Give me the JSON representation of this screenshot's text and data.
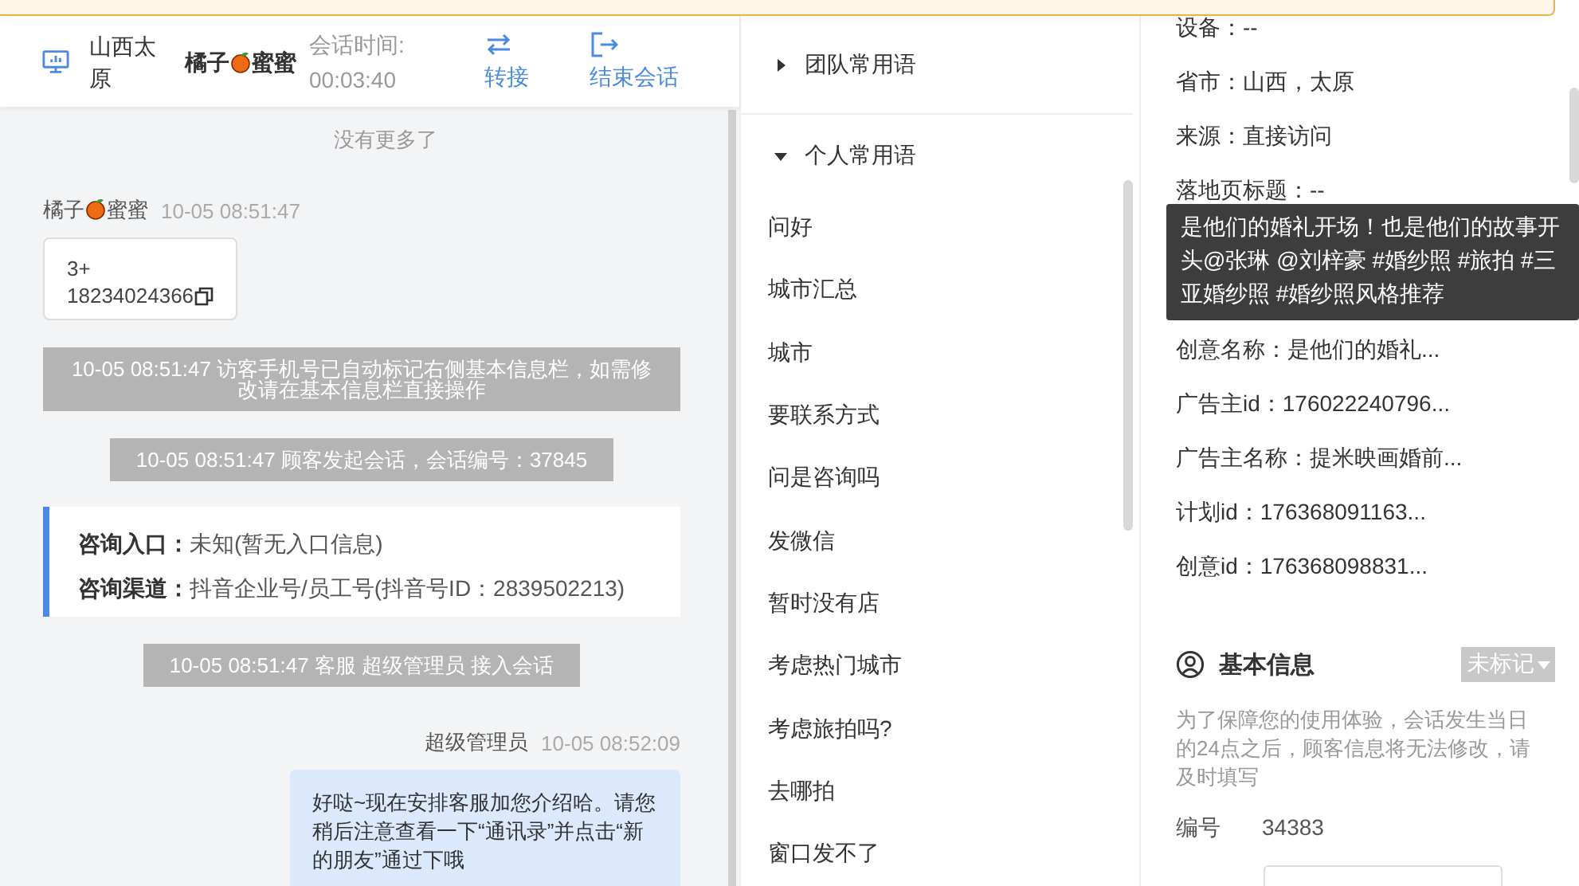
{
  "header": {
    "location": "山西太原",
    "visitor_name_parts": [
      "橘子",
      "蜜蜜"
    ],
    "session_label": "会话时间:",
    "session_time": "00:03:40",
    "actions": [
      {
        "kind": "transfer",
        "label": "转接"
      },
      {
        "kind": "end",
        "label": "结束会话"
      }
    ]
  },
  "chat": {
    "no_more": "没有更多了",
    "messages": [
      {
        "kind": "visitor",
        "name_parts": [
          "橘子",
          "蜜蜜"
        ],
        "time": "10-05 08:51:47",
        "lines": [
          "3+",
          "18234024366"
        ]
      },
      {
        "kind": "system",
        "text": "10-05 08:51:47 访客手机号已自动标记右侧基本信息栏，如需修改请在基本信息栏直接操作"
      },
      {
        "kind": "system",
        "text": "10-05 08:51:47 顾客发起会话，会话编号：37845"
      },
      {
        "kind": "info",
        "rows": [
          {
            "label": "咨询入口：",
            "value": "未知(暂无入口信息)"
          },
          {
            "label": "咨询渠道：",
            "value": "抖音企业号/员工号(抖音号ID：2839502213)"
          }
        ]
      },
      {
        "kind": "system",
        "text": "10-05 08:51:47 客服 超级管理员 接入会话"
      },
      {
        "kind": "agent",
        "name": "超级管理员",
        "time": "10-05 08:52:09",
        "text": "好哒~现在安排客服加您介绍哈。请您稍后注意查看一下“通讯录”并点击“新的朋友”通过下哦"
      }
    ]
  },
  "phrases": {
    "groups": [
      {
        "label": "团队常用语",
        "expanded": false
      },
      {
        "label": "个人常用语",
        "expanded": true,
        "items": [
          "问好",
          "城市汇总",
          "城市",
          "要联系方式",
          "问是咨询吗",
          "发微信",
          "暂时没有店",
          "考虑热门城市",
          "考虑旅拍吗?",
          "去哪拍",
          "窗口发不了"
        ]
      }
    ]
  },
  "info": {
    "rows_top": [
      "设备：--",
      "省市：山西，太原",
      "来源：直接访问",
      "落地页标题：--"
    ],
    "tooltip": "是他们的婚礼开场！也是他们的故事开头@张琳 @刘梓豪 #婚纱照 #旅拍 #三亚婚纱照 #婚纱照风格推荐",
    "rows_bottom": [
      "创意名称：是他们的婚礼...",
      "广告主id：176022240796...",
      "广告主名称：提米映画婚前...",
      "计划id：176368091163...",
      "创意id：176368098831..."
    ],
    "basic": {
      "title": "基本信息",
      "tag": "未标记",
      "note": "为了保障您的使用体验，会话发生当日的24点之后，顾客信息将无法修改，请及时填写",
      "fields": [
        {
          "label": "编号",
          "value": "34383"
        }
      ]
    }
  }
}
